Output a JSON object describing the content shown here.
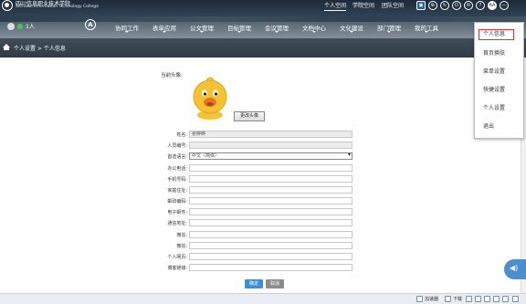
{
  "header": {
    "school_name_cn": "四川信息职业技术学院",
    "school_name_en": "SiChuan Information Technology College",
    "top_nav": [
      {
        "label": "个人空间",
        "active": true
      },
      {
        "label": "学院空间",
        "active": false
      },
      {
        "label": "团队空间",
        "active": false
      }
    ],
    "top_icons": [
      "user-icon",
      "gear-icon",
      "refresh-icon",
      "power-icon",
      "message-icon",
      "help-icon",
      "font-size-icon",
      "minimize-icon"
    ],
    "font_icon_label": "AA",
    "online_count": "1人",
    "nav_a_label": "A",
    "main_nav": [
      "协同工作",
      "表单应用",
      "公文管理",
      "目标管理",
      "会议管理",
      "文档中心",
      "文化建设",
      "部门管理",
      "我的工具"
    ]
  },
  "breadcrumb": "个人设置 > 个人信息",
  "form": {
    "avatar_label": "当前头像:",
    "change_avatar_button": "更改头像",
    "fields": [
      {
        "label": "姓名:",
        "value": "张婷婷",
        "readonly": true
      },
      {
        "label": "人员编号:",
        "value": "",
        "readonly": true
      },
      {
        "label": "首选语言:",
        "value": "中文（简体）",
        "type": "select"
      },
      {
        "label": "办公电话:",
        "value": ""
      },
      {
        "label": "手机号码:",
        "value": ""
      },
      {
        "label": "家庭住址:",
        "value": ""
      },
      {
        "label": "邮政编码:",
        "value": ""
      },
      {
        "label": "电子邮件:",
        "value": ""
      },
      {
        "label": "通信地址:",
        "value": ""
      },
      {
        "label": "微信:",
        "value": ""
      },
      {
        "label": "微信:",
        "value": ""
      },
      {
        "label": "个人网页:",
        "value": ""
      },
      {
        "label": "博客链接:",
        "value": ""
      }
    ],
    "ok_button": "确定",
    "cancel_button": "取消"
  },
  "popup_menu": {
    "items": [
      "个人信息",
      "首页换肤",
      "菜单设置",
      "快捷设置",
      "个人设置",
      "退出"
    ],
    "selected": "个人信息"
  },
  "statusbar": {
    "accelerator": "加速器",
    "download": "下载"
  },
  "colors": {
    "ok_button": "#3a8fd6",
    "cancel_button": "#8c8c8c",
    "popup_highlight": "#e23030",
    "online_dot": "#4cc44c"
  }
}
